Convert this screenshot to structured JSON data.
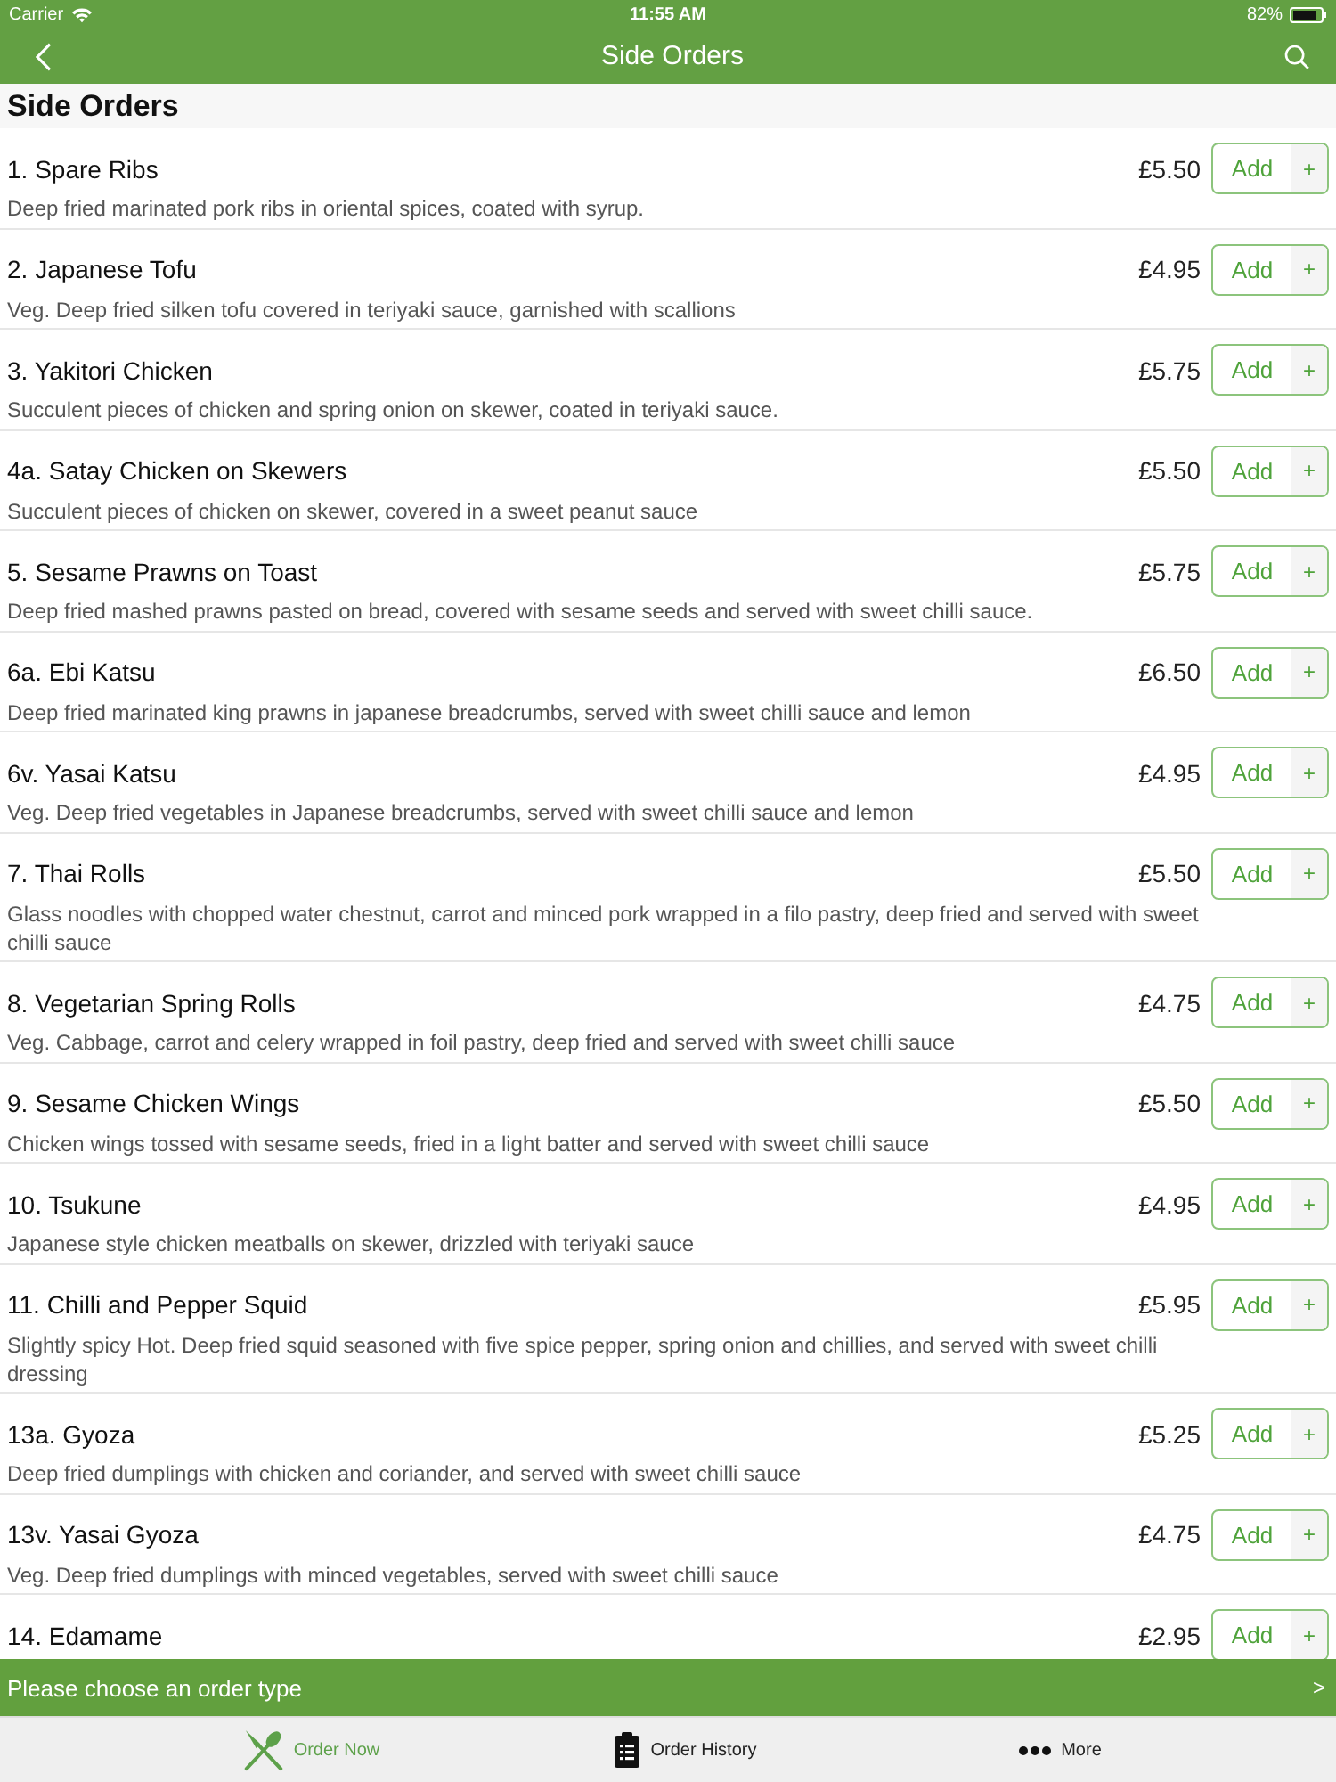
{
  "status_bar": {
    "carrier": "Carrier",
    "time": "11:55 AM",
    "battery": "82%"
  },
  "nav_bar": {
    "title": "Side Orders"
  },
  "section": {
    "title": "Side Orders"
  },
  "items": [
    {
      "name": "1. Spare Ribs",
      "price": "£5.50",
      "add_label": "Add",
      "add_plus": "+",
      "description": "Deep fried marinated pork ribs in oriental spices, coated with syrup."
    },
    {
      "name": "2. Japanese Tofu",
      "price": "£4.95",
      "add_label": "Add",
      "add_plus": "+",
      "description": "Veg. Deep fried silken tofu covered in teriyaki sauce, garnished with scallions"
    },
    {
      "name": "3. Yakitori Chicken",
      "price": "£5.75",
      "add_label": "Add",
      "add_plus": "+",
      "description": "Succulent pieces of chicken and spring onion on skewer, coated in teriyaki sauce."
    },
    {
      "name": "4a. Satay Chicken on Skewers",
      "price": "£5.50",
      "add_label": "Add",
      "add_plus": "+",
      "description": "Succulent pieces of chicken on skewer, covered in a sweet peanut sauce"
    },
    {
      "name": "5. Sesame Prawns on Toast",
      "price": "£5.75",
      "add_label": "Add",
      "add_plus": "+",
      "description": "Deep fried mashed prawns pasted on bread, covered with sesame seeds and served with sweet chilli sauce."
    },
    {
      "name": "6a. Ebi Katsu",
      "price": "£6.50",
      "add_label": "Add",
      "add_plus": "+",
      "description": "Deep fried marinated king prawns in japanese breadcrumbs, served with sweet chilli sauce and lemon"
    },
    {
      "name": "6v. Yasai Katsu",
      "price": "£4.95",
      "add_label": "Add",
      "add_plus": "+",
      "description": "Veg. Deep fried vegetables in Japanese breadcrumbs, served with sweet chilli sauce and lemon"
    },
    {
      "name": "7. Thai Rolls",
      "price": "£5.50",
      "add_label": "Add",
      "add_plus": "+",
      "description": "Glass noodles with chopped water chestnut, carrot and minced pork wrapped in a filo pastry, deep fried and served with sweet chilli sauce"
    },
    {
      "name": "8. Vegetarian Spring Rolls",
      "price": "£4.75",
      "add_label": "Add",
      "add_plus": "+",
      "description": "Veg. Cabbage, carrot and celery wrapped in foil pastry, deep fried and served with sweet chilli sauce"
    },
    {
      "name": "9. Sesame Chicken Wings",
      "price": "£5.50",
      "add_label": "Add",
      "add_plus": "+",
      "description": "Chicken wings tossed with sesame seeds, fried in a light batter and served with sweet chilli sauce"
    },
    {
      "name": "10. Tsukune",
      "price": "£4.95",
      "add_label": "Add",
      "add_plus": "+",
      "description": "Japanese style chicken meatballs on skewer, drizzled with teriyaki sauce"
    },
    {
      "name": "11. Chilli and Pepper Squid",
      "price": "£5.95",
      "add_label": "Add",
      "add_plus": "+",
      "description": "Slightly spicy Hot. Deep fried squid seasoned with five spice pepper, spring onion and chillies, and served with sweet chilli dressing"
    },
    {
      "name": "13a. Gyoza",
      "price": "£5.25",
      "add_label": "Add",
      "add_plus": "+",
      "description": "Deep fried dumplings with chicken and coriander, and served with sweet chilli sauce"
    },
    {
      "name": "13v. Yasai Gyoza",
      "price": "£4.75",
      "add_label": "Add",
      "add_plus": "+",
      "description": "Veg. Deep fried dumplings with minced vegetables, served with sweet chilli sauce"
    },
    {
      "name": "14. Edamame",
      "price": "£2.95",
      "add_label": "Add",
      "add_plus": "+"
    }
  ],
  "order_type_bar": {
    "label": "Please choose an order type",
    "chevron": ">"
  },
  "tabs": [
    {
      "kind": "order",
      "label": "Order Now",
      "selected": true
    },
    {
      "kind": "history",
      "label": "Order History",
      "selected": false
    },
    {
      "kind": "more",
      "label": "More",
      "selected": false
    }
  ]
}
